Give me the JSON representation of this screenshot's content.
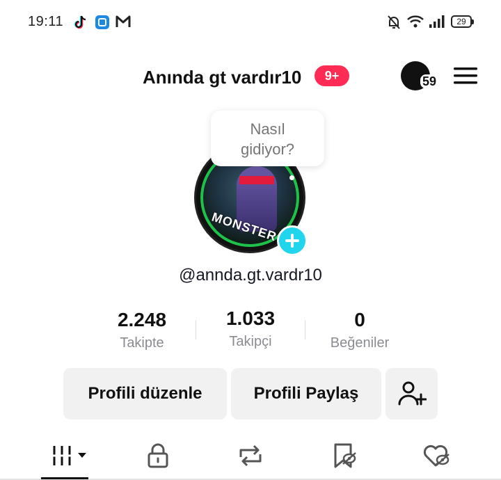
{
  "status_bar": {
    "time": "19:11",
    "left_icons": [
      "tiktok-icon",
      "app-square-icon",
      "gmail-icon"
    ],
    "right_icons": [
      "bell-muted-icon",
      "wifi-icon",
      "signal-icon",
      "battery-icon"
    ],
    "battery_level": "29"
  },
  "header": {
    "profile_name": "Anında gt vardır10",
    "notification_badge": "9+",
    "story_count": "59",
    "menu_icon": "hamburger-menu-icon",
    "accent_color": "#fe2c55"
  },
  "avatar": {
    "bubble_text_line1": "Nasıl",
    "bubble_text_line2": "gidiyor?",
    "image_text": "MONSTER A",
    "add_button_color": "#20d5ec"
  },
  "profile": {
    "username": "@annda.gt.vardr10"
  },
  "stats": [
    {
      "value": "2.248",
      "label": "Takipte"
    },
    {
      "value": "1.033",
      "label": "Takipçi"
    },
    {
      "value": "0",
      "label": "Beğeniler"
    }
  ],
  "actions": {
    "edit_profile": "Profili düzenle",
    "share_profile": "Profili Paylaş",
    "add_friend_icon": "add-friend-icon"
  },
  "tabs": [
    {
      "icon": "videos-grid-icon",
      "active": true
    },
    {
      "icon": "lock-icon",
      "active": false
    },
    {
      "icon": "repost-icon",
      "active": false
    },
    {
      "icon": "bookmark-icon",
      "active": false
    },
    {
      "icon": "liked-heart-icon",
      "active": false
    }
  ]
}
